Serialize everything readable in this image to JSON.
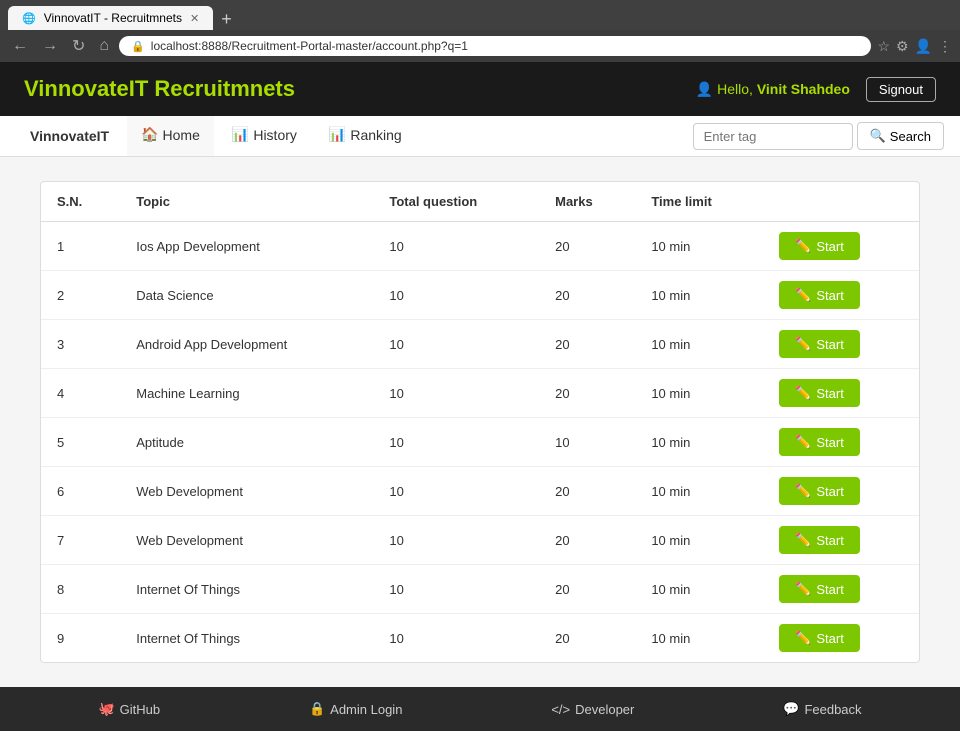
{
  "browser": {
    "tab_title": "VinnovatIT - Recruitmnets",
    "url": "localhost:8888/Recruitment-Portal-master/account.php?q=1",
    "new_tab_label": "+"
  },
  "header": {
    "title": "VinnovateIT Recruitmnets",
    "hello_text": "Hello,",
    "user_name": "Vinit Shahdeo",
    "signout_label": "Signout"
  },
  "nav": {
    "brand": "VinnovateIT",
    "items": [
      {
        "label": "Home",
        "icon": "🏠",
        "active": true
      },
      {
        "label": "History",
        "icon": "📊",
        "active": false
      },
      {
        "label": "Ranking",
        "icon": "📊",
        "active": false
      }
    ],
    "tag_placeholder": "Enter tag",
    "search_label": "Search"
  },
  "table": {
    "columns": [
      "S.N.",
      "Topic",
      "Total question",
      "Marks",
      "Time limit",
      ""
    ],
    "rows": [
      {
        "sn": "1",
        "topic": "Ios App Development",
        "total_question": "10",
        "marks": "20",
        "time_limit": "10 min"
      },
      {
        "sn": "2",
        "topic": "Data Science",
        "total_question": "10",
        "marks": "20",
        "time_limit": "10 min"
      },
      {
        "sn": "3",
        "topic": "Android App Development",
        "total_question": "10",
        "marks": "20",
        "time_limit": "10 min"
      },
      {
        "sn": "4",
        "topic": "Machine Learning",
        "total_question": "10",
        "marks": "20",
        "time_limit": "10 min"
      },
      {
        "sn": "5",
        "topic": "Aptitude",
        "total_question": "10",
        "marks": "10",
        "time_limit": "10 min"
      },
      {
        "sn": "6",
        "topic": "Web Development",
        "total_question": "10",
        "marks": "20",
        "time_limit": "10 min"
      },
      {
        "sn": "7",
        "topic": "Web Development",
        "total_question": "10",
        "marks": "20",
        "time_limit": "10 min"
      },
      {
        "sn": "8",
        "topic": "Internet Of Things",
        "total_question": "10",
        "marks": "20",
        "time_limit": "10 min"
      },
      {
        "sn": "9",
        "topic": "Internet Of Things",
        "total_question": "10",
        "marks": "20",
        "time_limit": "10 min"
      }
    ],
    "start_label": "Start"
  },
  "footer": {
    "github_label": "GitHub",
    "admin_label": "Admin Login",
    "developer_label": "Developer",
    "feedback_label": "Feedback"
  }
}
